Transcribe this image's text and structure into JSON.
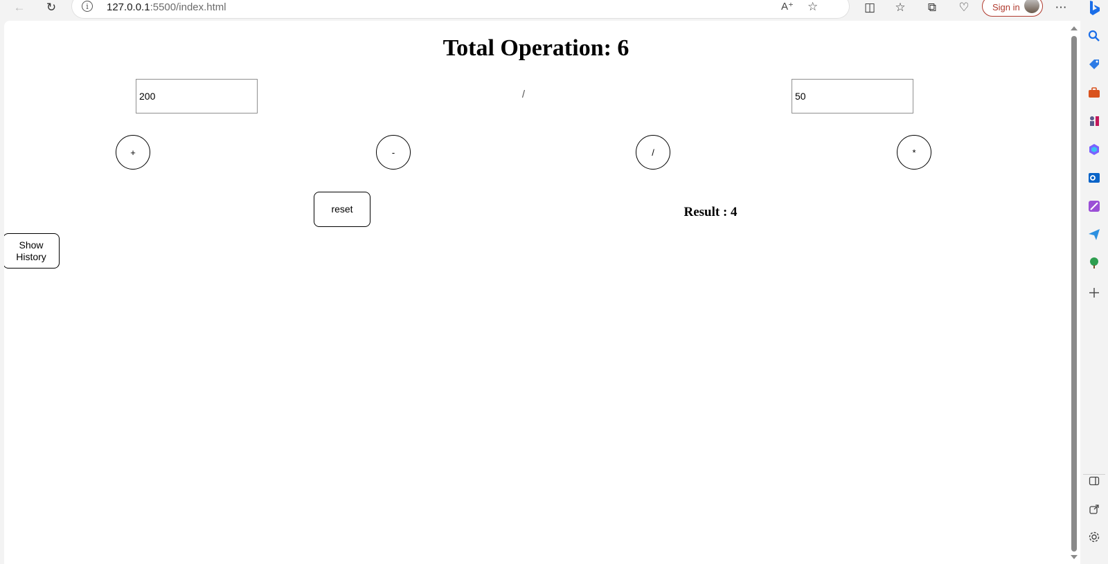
{
  "browser": {
    "url_host": "127.0.0.1",
    "url_rest": ":5500/index.html",
    "sign_in_label": "Sign in"
  },
  "page": {
    "title": "Total Operation: 6",
    "first_number": "200",
    "second_number": "50",
    "current_operator": "/",
    "operators": {
      "add": "+",
      "subtract": "-",
      "divide": "/",
      "multiply": "*"
    },
    "reset_label": "reset",
    "show_history_label": "Show History",
    "result_label": "Result : ",
    "result_value": "4"
  }
}
